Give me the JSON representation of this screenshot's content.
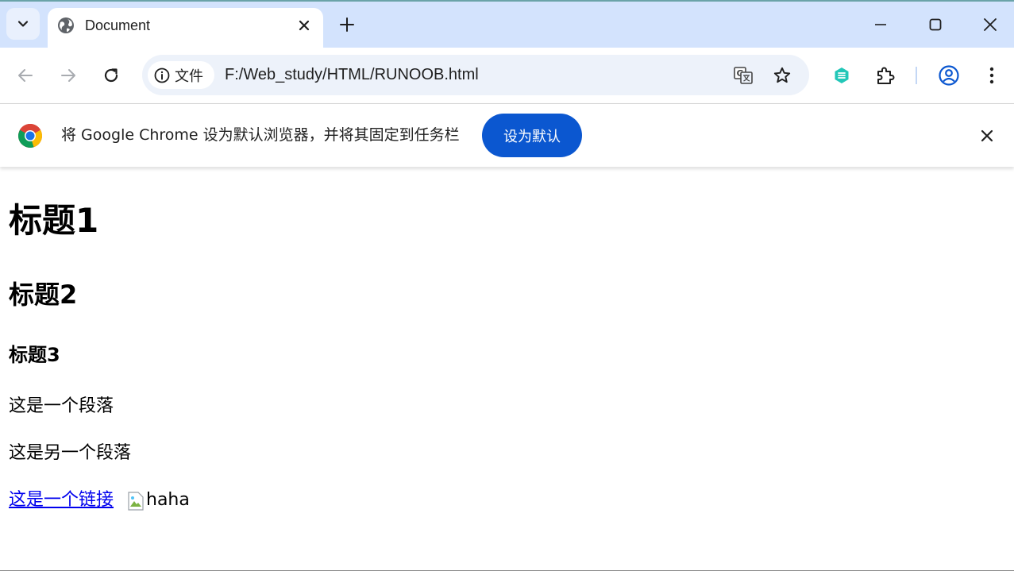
{
  "browser": {
    "tab": {
      "title": "Document"
    },
    "omnibox": {
      "chip_label": "文件",
      "url": "F:/Web_study/HTML/RUNOOB.html"
    },
    "icons": {
      "tab_search": "chevron-down-icon",
      "favicon": "globe-icon",
      "tab_close": "close-icon",
      "new_tab": "plus-icon",
      "minimize": "minimize-icon",
      "maximize": "maximize-icon",
      "window_close": "close-icon",
      "back": "arrow-left-icon",
      "forward": "arrow-right-icon",
      "reload": "reload-icon",
      "site_info": "info-icon",
      "translate": "translate-icon",
      "bookmark": "star-icon",
      "extension": "extension-icon",
      "extensions_menu": "puzzle-icon",
      "profile": "profile-icon",
      "menu": "kebab-menu-icon"
    },
    "colors": {
      "tabstrip_bg": "#d3e3fd",
      "omnibox_bg": "#edf2fa",
      "accent_button": "#0b57d0",
      "link": "#0000ee"
    }
  },
  "infobar": {
    "message": "将 Google Chrome 设为默认浏览器，并将其固定到任务栏",
    "button_label": "设为默认"
  },
  "page": {
    "h1": "标题1",
    "h2": "标题2",
    "h3": "标题3",
    "paragraph1": "这是一个段落",
    "paragraph2": "这是另一个段落",
    "link_text": "这是一个链接",
    "image_alt": "haha"
  }
}
